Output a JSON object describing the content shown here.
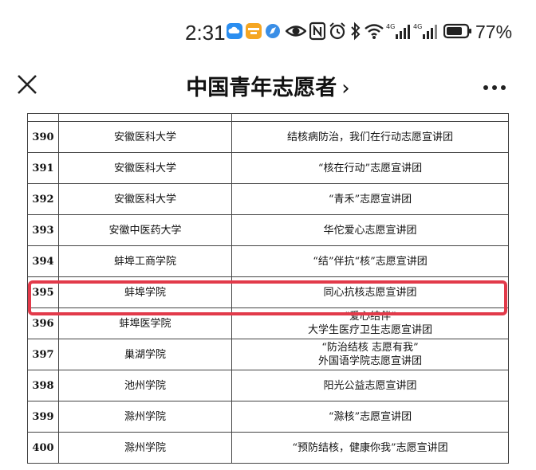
{
  "status_bar": {
    "time": "2:31",
    "battery": "77%",
    "icons": [
      "cloud-app-icon",
      "imoo-app-icon",
      "compass-app-icon",
      "eye-icon",
      "nfc-icon",
      "alarm-icon",
      "bluetooth-icon",
      "wifi-icon",
      "4g-signal-icon",
      "4g-signal-icon",
      "battery-icon"
    ]
  },
  "nav": {
    "title": "中国青年志愿者",
    "chevron": "›"
  },
  "highlight_color": "#e23a4a",
  "table": {
    "rows": [
      {
        "num": "390",
        "school": "安徽医科大学",
        "team": [
          "结核病防治，我们在行动志愿宣讲团"
        ]
      },
      {
        "num": "391",
        "school": "安徽医科大学",
        "team": [
          "“核在行动”志愿宣讲团"
        ]
      },
      {
        "num": "392",
        "school": "安徽医科大学",
        "team": [
          "“青禾”志愿宣讲团"
        ]
      },
      {
        "num": "393",
        "school": "安徽中医药大学",
        "team": [
          "华佗爱心志愿宣讲团"
        ]
      },
      {
        "num": "394",
        "school": "蚌埠工商学院",
        "team": [
          "“结”伴抗“核”志愿宣讲团"
        ]
      },
      {
        "num": "395",
        "school": "蚌埠学院",
        "team": [
          "同心抗核志愿宣讲团"
        ]
      },
      {
        "num": "396",
        "school": "蚌埠医学院",
        "team": [
          "“爱心结伴”",
          "大学生医疗卫生志愿宣讲团"
        ]
      },
      {
        "num": "397",
        "school": "巢湖学院",
        "team": [
          "“防治结核 志愿有我”",
          "外国语学院志愿宣讲团"
        ]
      },
      {
        "num": "398",
        "school": "池州学院",
        "team": [
          "阳光公益志愿宣讲团"
        ]
      },
      {
        "num": "399",
        "school": "滁州学院",
        "team": [
          "“滁核”志愿宣讲团"
        ]
      },
      {
        "num": "400",
        "school": "滁州学院",
        "team": [
          "“预防结核，健康你我”志愿宣讲团"
        ]
      }
    ]
  }
}
